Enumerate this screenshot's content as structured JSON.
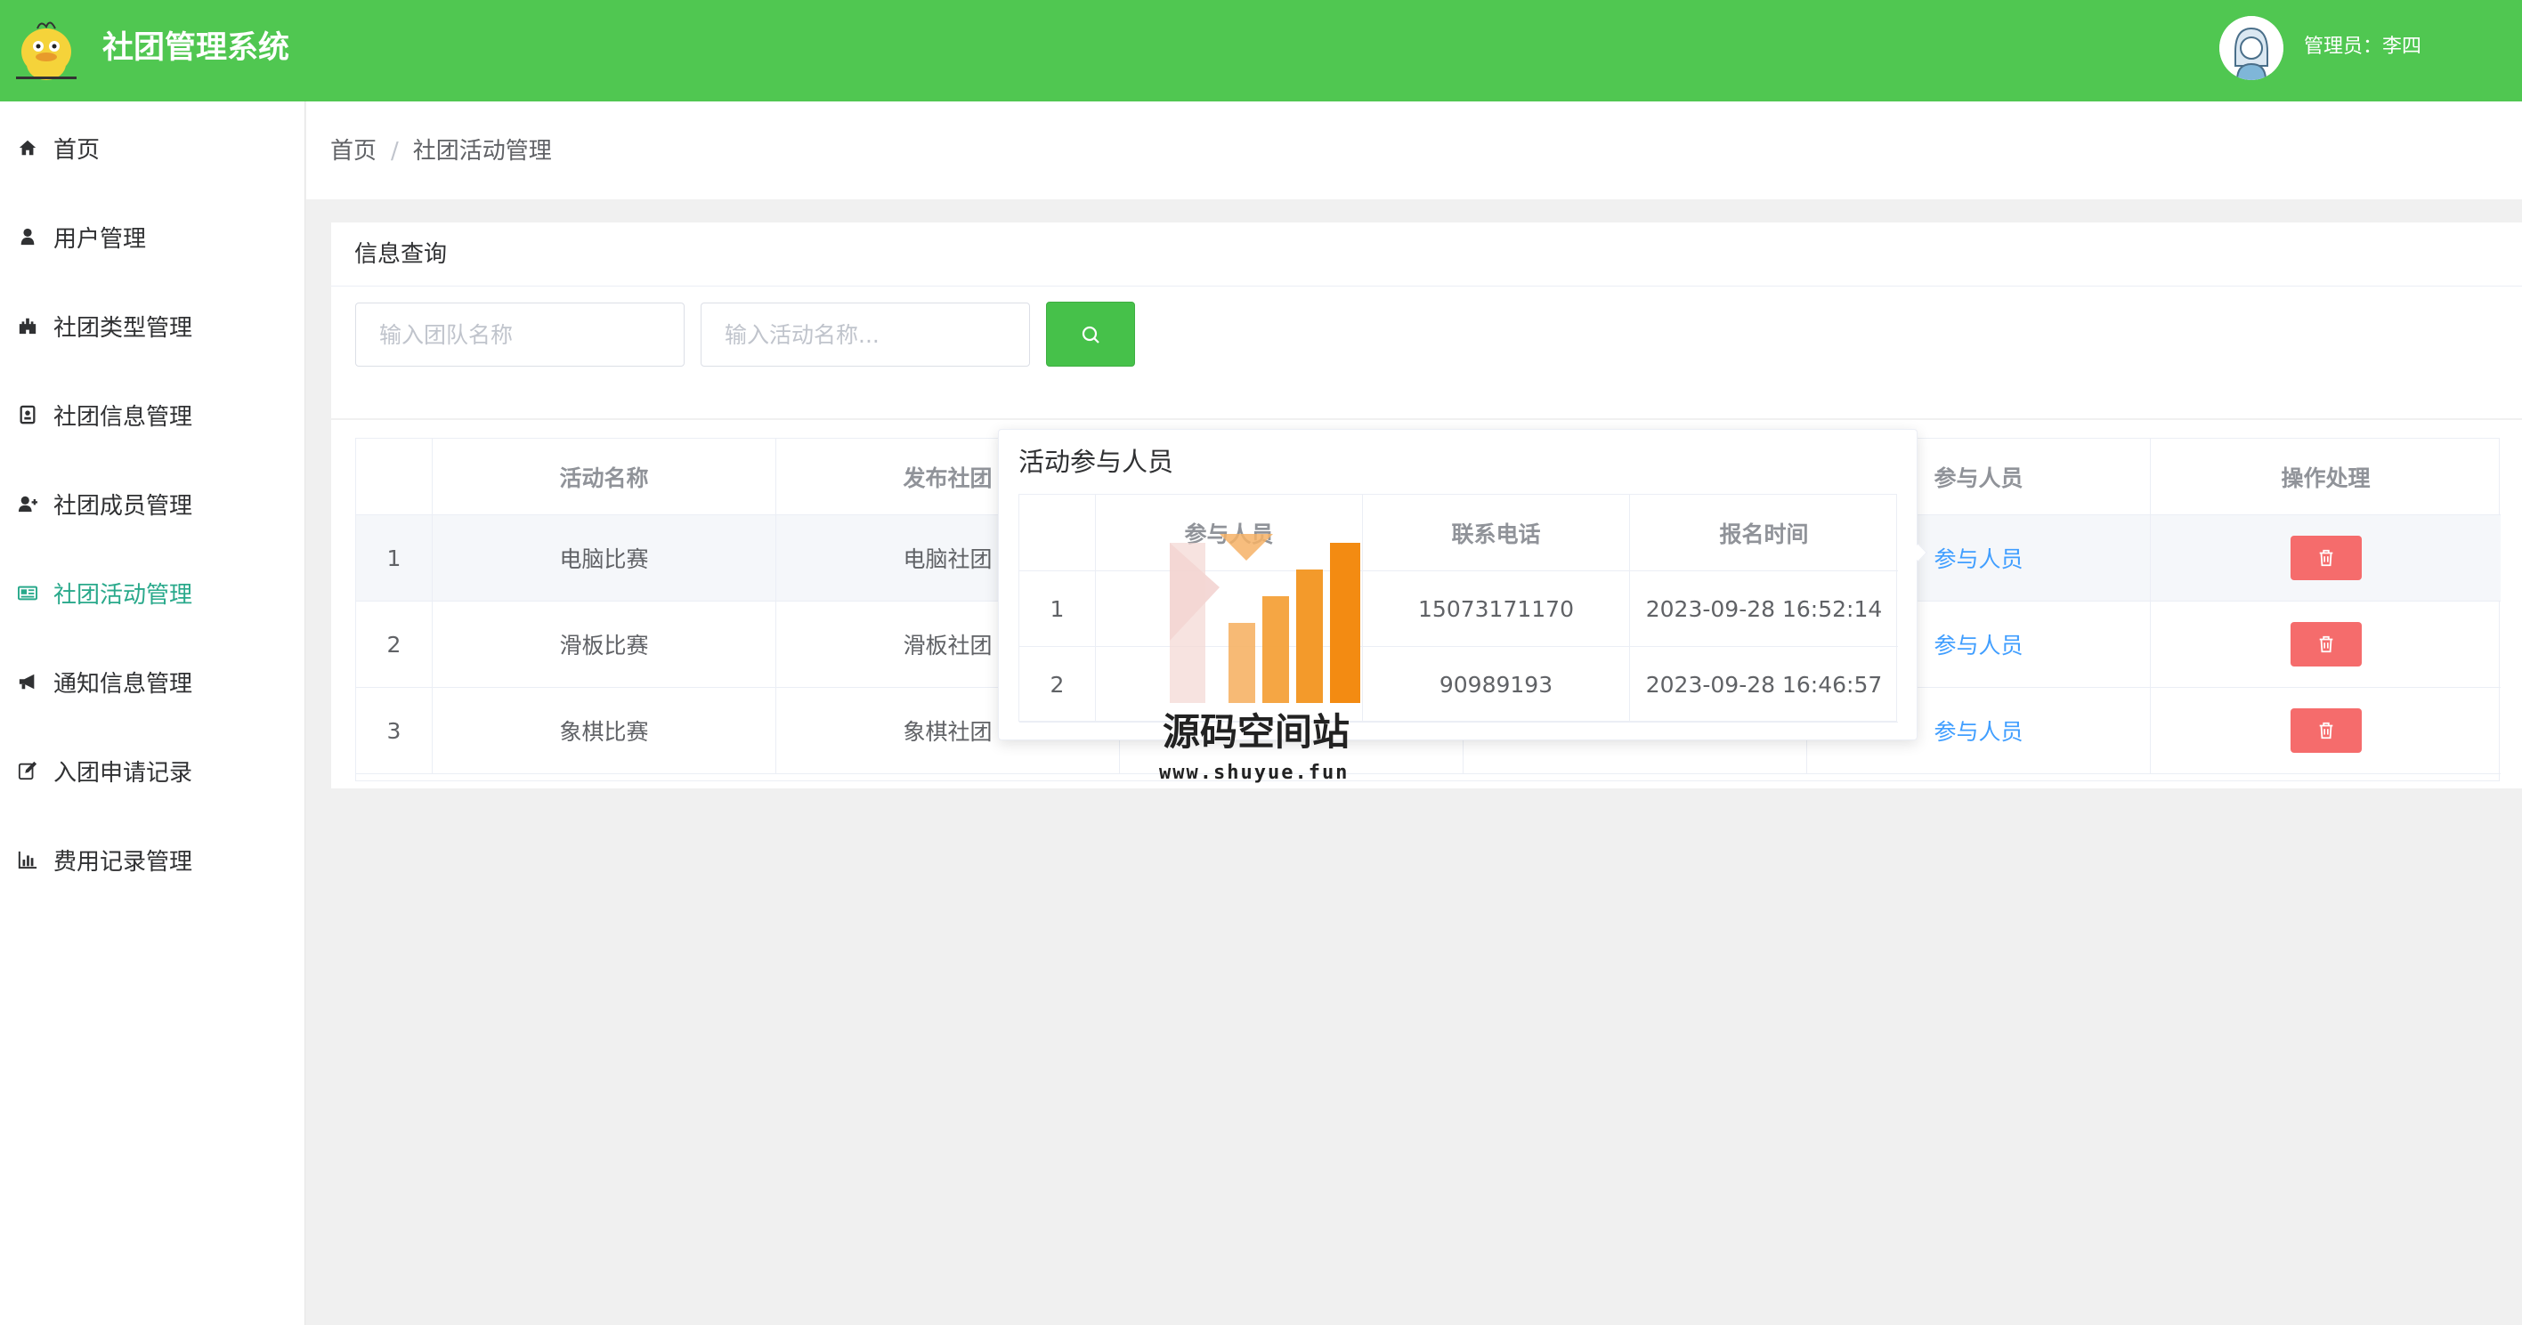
{
  "header": {
    "app_title": "社团管理系统",
    "user_label": "管理员：李四"
  },
  "sidebar": {
    "items": [
      {
        "label": "首页",
        "icon": "home-icon"
      },
      {
        "label": "用户管理",
        "icon": "user-icon"
      },
      {
        "label": "社团类型管理",
        "icon": "castle-icon"
      },
      {
        "label": "社团信息管理",
        "icon": "id-card-icon"
      },
      {
        "label": "社团成员管理",
        "icon": "user-plus-icon"
      },
      {
        "label": "社团活动管理",
        "icon": "newspaper-icon",
        "active": true
      },
      {
        "label": "通知信息管理",
        "icon": "bullhorn-icon"
      },
      {
        "label": "入团申请记录",
        "icon": "edit-icon"
      },
      {
        "label": "费用记录管理",
        "icon": "bar-chart-icon"
      }
    ]
  },
  "breadcrumb": {
    "home": "首页",
    "separator": "/",
    "current": "社团活动管理"
  },
  "search": {
    "title": "信息查询",
    "team_placeholder": "输入团队名称",
    "activity_placeholder": "输入活动名称..."
  },
  "table": {
    "headers": {
      "name": "活动名称",
      "club": "发布社团",
      "participants": "参与人员",
      "actions": "操作处理"
    },
    "rows": [
      {
        "index": "1",
        "name": "电脑比赛",
        "club": "电脑社团",
        "participants_link": "参与人员"
      },
      {
        "index": "2",
        "name": "滑板比赛",
        "club": "滑板社团",
        "participants_link": "参与人员"
      },
      {
        "index": "3",
        "name": "象棋比赛",
        "club": "象棋社团",
        "participants_link": "参与人员"
      }
    ]
  },
  "popover": {
    "title": "活动参与人员",
    "headers": {
      "person": "参与人员",
      "phone": "联系电话",
      "time": "报名时间"
    },
    "rows": [
      {
        "index": "1",
        "person": "",
        "phone": "15073171170",
        "time": "2023-09-28 16:52:14"
      },
      {
        "index": "2",
        "person": "",
        "phone": "90989193",
        "time": "2023-09-28 16:46:57"
      }
    ]
  },
  "watermark": {
    "name": "源码空间站",
    "url": "www.shuyue.fun"
  },
  "colors": {
    "header": "#50c751",
    "active_nav": "#29a98b",
    "search_button": "#46c14a",
    "danger": "#f56c6c",
    "link": "#409eff"
  }
}
